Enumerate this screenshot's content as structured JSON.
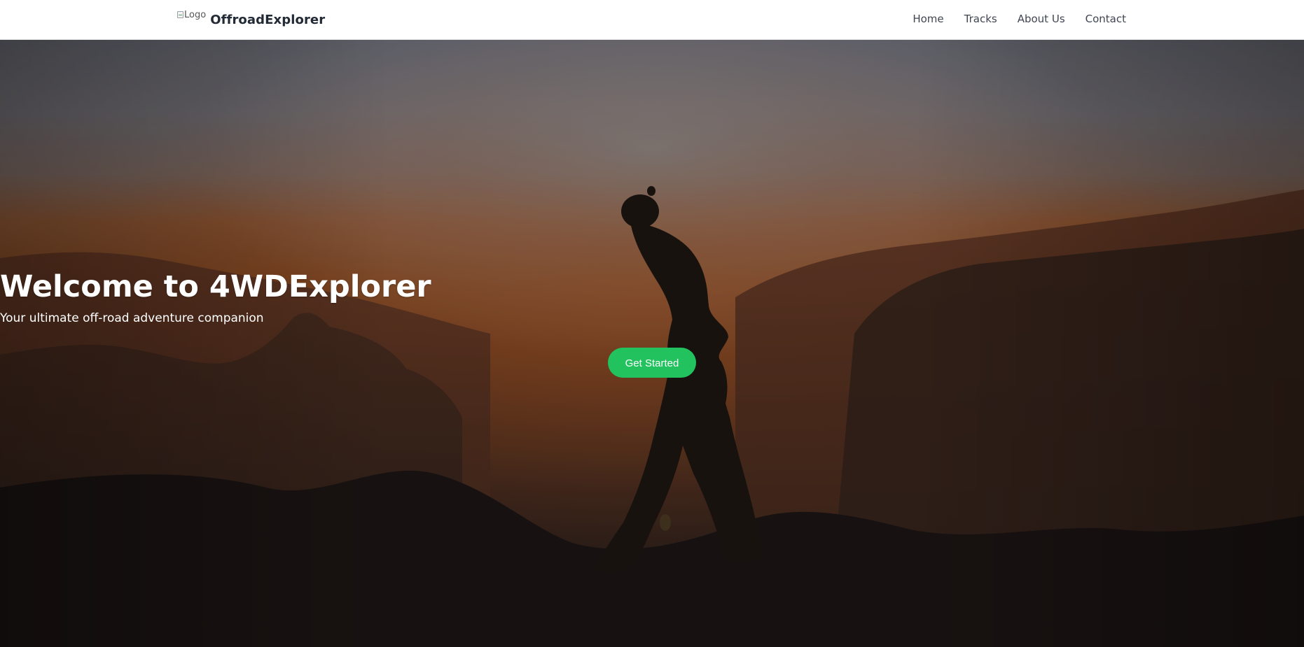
{
  "navbar": {
    "logo_alt": "Logo",
    "brand": "OffroadExplorer",
    "links": [
      "Home",
      "Tracks",
      "About Us",
      "Contact"
    ]
  },
  "hero": {
    "title": "Welcome to 4WDExplorer",
    "subtitle": "Your ultimate off-road adventure companion",
    "cta_label": "Get Started",
    "background_image": "silhouette of a person standing on a mountain ridge at sunset"
  },
  "colors": {
    "accent": "#22c35e",
    "nav_text": "#3f4652",
    "brand_text": "#222a36"
  }
}
